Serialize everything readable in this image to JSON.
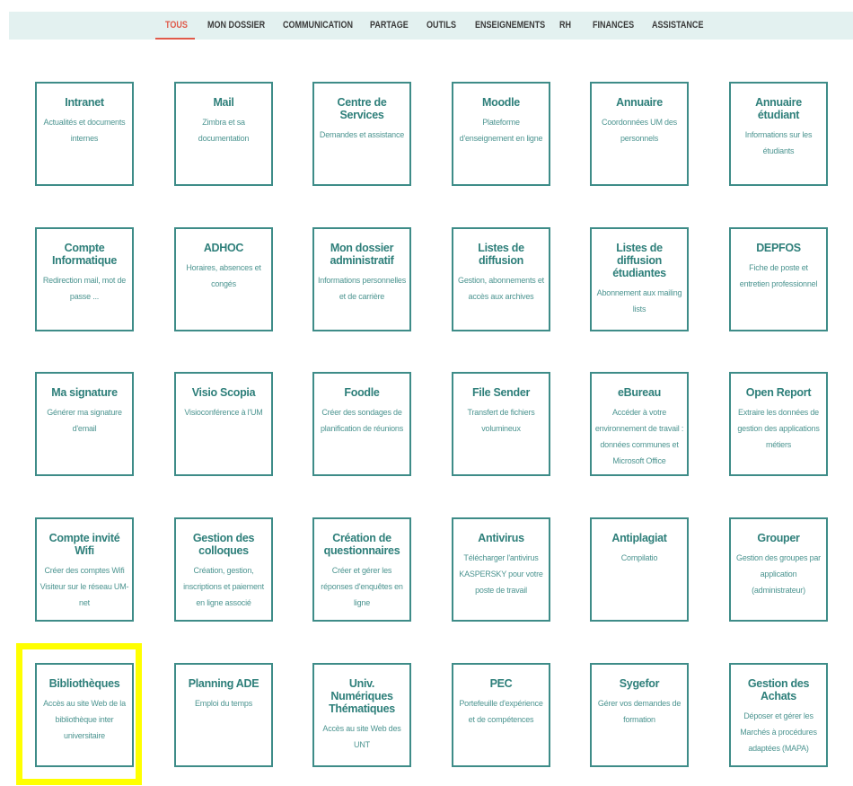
{
  "nav": {
    "items": [
      {
        "label": "TOUS",
        "active": true
      },
      {
        "label": "MON DOSSIER",
        "active": false
      },
      {
        "label": "COMMUNICATION",
        "active": false
      },
      {
        "label": "PARTAGE",
        "active": false
      },
      {
        "label": "OUTILS",
        "active": false
      },
      {
        "label": "ENSEIGNEMENTS",
        "active": false
      },
      {
        "label": "RH",
        "active": false
      },
      {
        "label": "FINANCES",
        "active": false
      },
      {
        "label": "ASSISTANCE",
        "active": false
      }
    ]
  },
  "tiles": [
    {
      "title": "Intranet",
      "desc": "Actualités et documents internes"
    },
    {
      "title": "Mail",
      "desc": "Zimbra et sa documentation"
    },
    {
      "title": "Centre de Services",
      "desc": "Demandes et assistance"
    },
    {
      "title": "Moodle",
      "desc": "Plateforme d'enseignement en ligne"
    },
    {
      "title": "Annuaire",
      "desc": "Coordonnées UM des personnels"
    },
    {
      "title": "Annuaire étudiant",
      "desc": "Informations sur les étudiants"
    },
    {
      "title": "Compte Informatique",
      "desc": "Redirection mail, mot de passe ..."
    },
    {
      "title": "ADHOC",
      "desc": "Horaires, absences et congés"
    },
    {
      "title": "Mon dossier administratif",
      "desc": "Informations personnelles et de carrière"
    },
    {
      "title": "Listes de diffusion",
      "desc": "Gestion, abonnements et accès aux archives"
    },
    {
      "title": "Listes de diffusion étudiantes",
      "desc": "Abonnement aux mailing lists"
    },
    {
      "title": "DEPFOS",
      "desc": "Fiche de poste et entretien professionnel"
    },
    {
      "title": "Ma signature",
      "desc": "Générer ma signature d'email"
    },
    {
      "title": "Visio Scopia",
      "desc": "Visioconférence à l'UM"
    },
    {
      "title": "Foodle",
      "desc": "Créer des sondages de planification de réunions"
    },
    {
      "title": "File Sender",
      "desc": "Transfert de fichiers volumineux"
    },
    {
      "title": "eBureau",
      "desc": "Accéder à votre environnement de travail : données communes et Microsoft Office"
    },
    {
      "title": "Open Report",
      "desc": "Extraire les données de gestion des applications métiers"
    },
    {
      "title": "Compte invité Wifi",
      "desc": "Créer des comptes Wifi Visiteur sur le réseau UM-net"
    },
    {
      "title": "Gestion des colloques",
      "desc": "Création, gestion, inscriptions et paiement en ligne associé"
    },
    {
      "title": "Création de questionnaires",
      "desc": "Créer et gérer les réponses d'enquêtes en ligne"
    },
    {
      "title": "Antivirus",
      "desc": "Télécharger l'antivirus KASPERSKY pour votre poste de travail"
    },
    {
      "title": "Antiplagiat",
      "desc": "Compilatio"
    },
    {
      "title": "Grouper",
      "desc": "Gestion des groupes par application (administrateur)"
    },
    {
      "title": "Bibliothèques",
      "desc": "Accès au site Web de la bibliothèque inter universitaire"
    },
    {
      "title": "Planning ADE",
      "desc": "Emploi du temps"
    },
    {
      "title": "Univ. Numériques Thématiques",
      "desc": "Accès au site Web des UNT"
    },
    {
      "title": "PEC",
      "desc": "Portefeuille d'expérience et de compétences"
    },
    {
      "title": "Sygefor",
      "desc": "Gérer vos demandes de formation"
    },
    {
      "title": "Gestion des Achats",
      "desc": "Déposer et gérer les Marchés à procédures adaptées (MAPA)"
    }
  ],
  "colors": {
    "accent": "#e05a4a",
    "tile_border": "#3e8c88",
    "tile_text": "#2e7f7a",
    "navbar_bg": "#e3f1f0",
    "highlight": "#ffff00"
  }
}
